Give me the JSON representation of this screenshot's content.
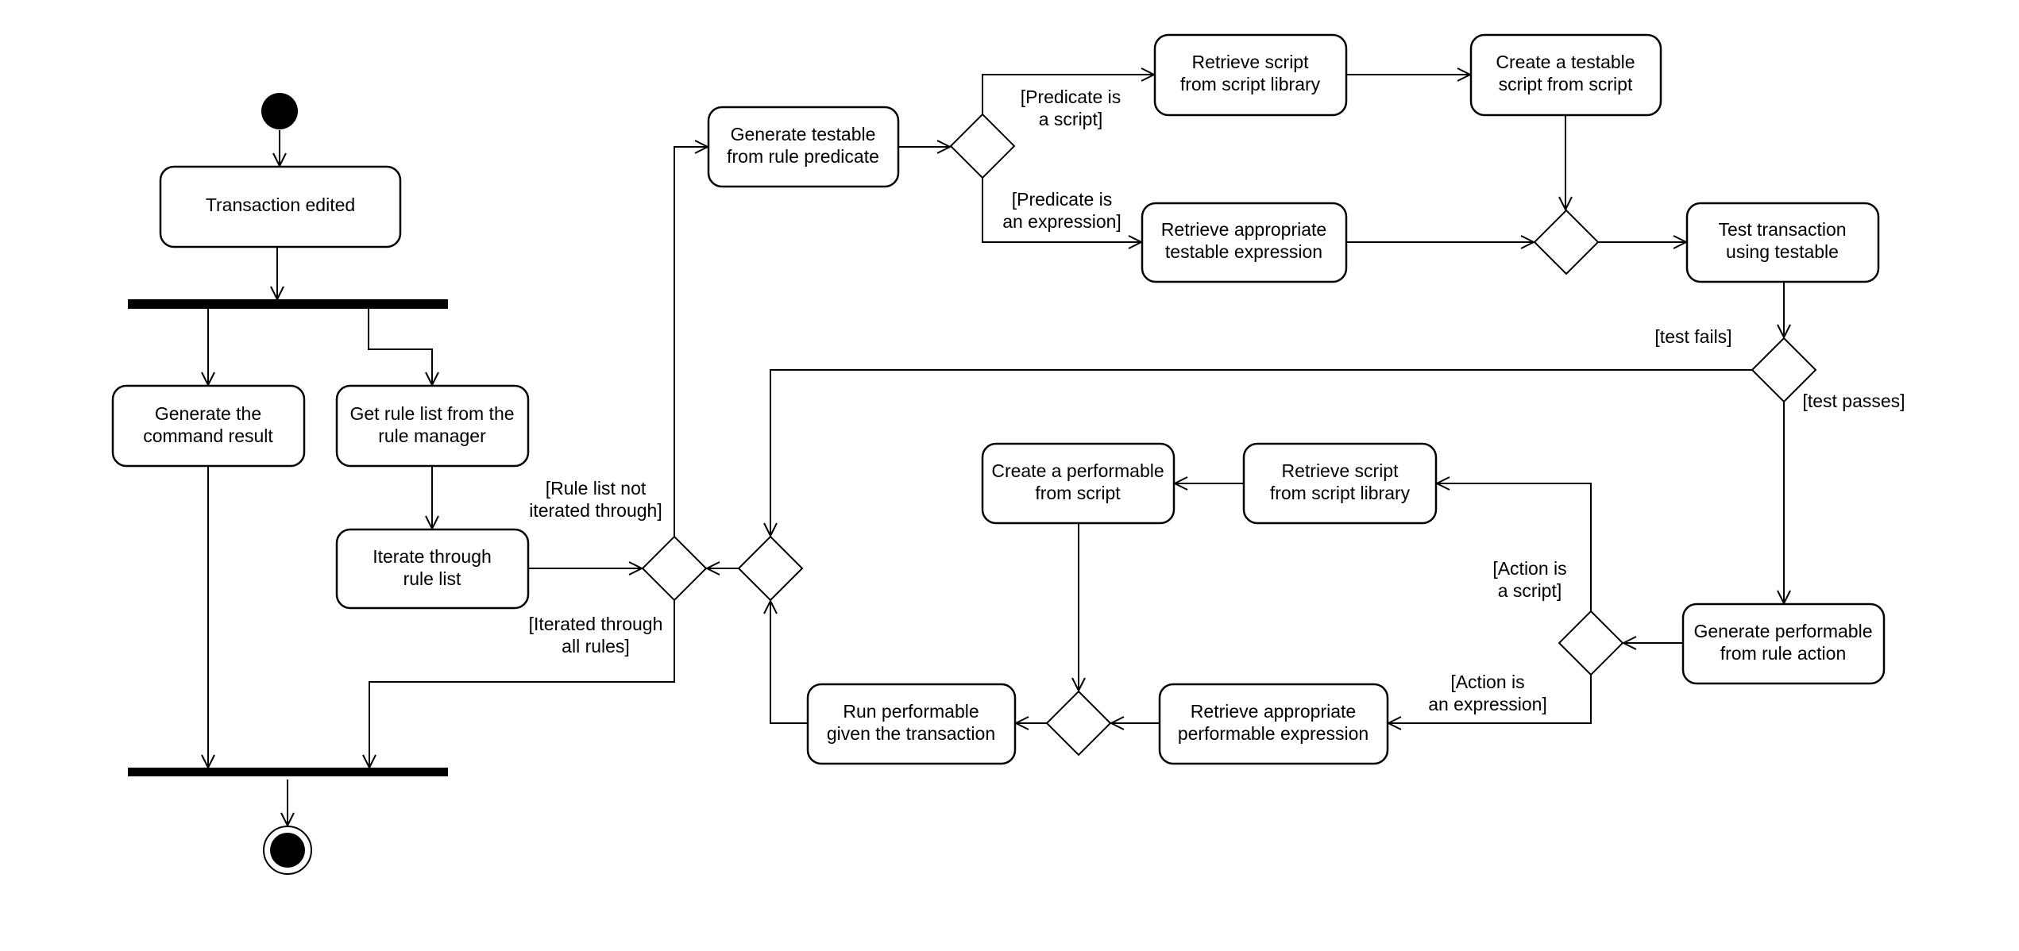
{
  "diagram": {
    "type": "UML activity diagram",
    "colors": {
      "stroke": "#000000",
      "fill": "#ffffff"
    },
    "activities": {
      "transaction_edited": [
        "Transaction edited"
      ],
      "generate_command_result": [
        "Generate the",
        "command result"
      ],
      "get_rule_list": [
        "Get rule list from the",
        "rule manager"
      ],
      "iterate_rule_list": [
        "Iterate through",
        "rule list"
      ],
      "generate_testable": [
        "Generate testable",
        "from rule predicate"
      ],
      "retrieve_script_testable": [
        "Retrieve script",
        "from script library"
      ],
      "create_testable_script": [
        "Create a testable",
        "script from script"
      ],
      "retrieve_testable_expression": [
        "Retrieve appropriate",
        "testable expression"
      ],
      "test_transaction": [
        "Test transaction",
        "using testable"
      ],
      "generate_performable": [
        "Generate performable",
        "from rule action"
      ],
      "retrieve_script_performable": [
        "Retrieve script",
        "from script library"
      ],
      "create_performable": [
        "Create a performable",
        "from script"
      ],
      "retrieve_performable_expression": [
        "Retrieve appropriate",
        "performable expression"
      ],
      "run_performable": [
        "Run performable",
        "given the transaction"
      ]
    },
    "guards": {
      "rule_list_not_iterated": [
        "[Rule list not",
        "iterated through]"
      ],
      "iterated_all_rules": [
        "[Iterated through",
        "all rules]"
      ],
      "predicate_script": [
        "[Predicate is",
        "a script]"
      ],
      "predicate_expression": [
        "[Predicate is",
        "an expression]"
      ],
      "test_fails": [
        "[test fails]"
      ],
      "test_passes": [
        "[test passes]"
      ],
      "action_script": [
        "[Action is",
        "a script]"
      ],
      "action_expression": [
        "[Action is",
        "an expression]"
      ]
    }
  }
}
